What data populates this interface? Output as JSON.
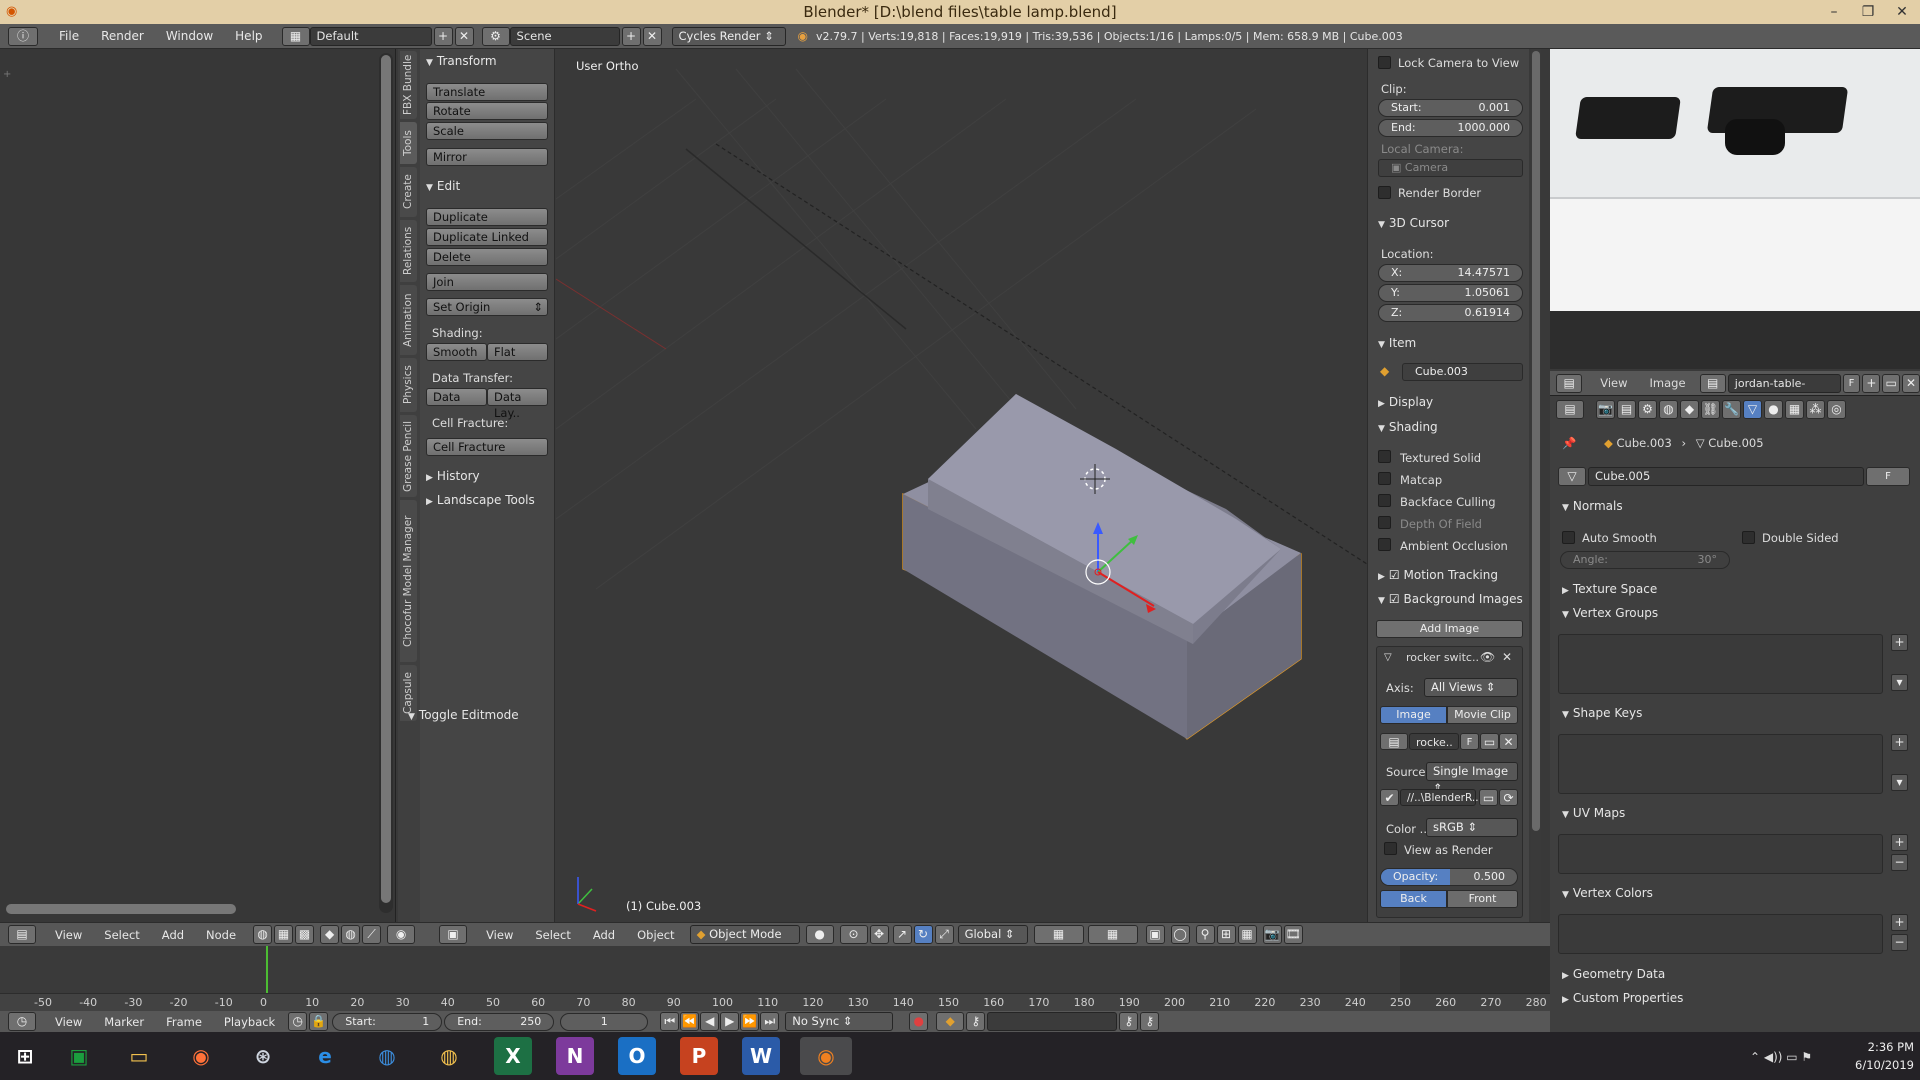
{
  "title": "Blender* [D:\\blend files\\table lamp.blend]",
  "menu": [
    "File",
    "Render",
    "Window",
    "Help"
  ],
  "layout": "Default",
  "scene": "Scene",
  "engine": "Cycles Render",
  "stats": "v2.79.7 | Verts:19,818 | Faces:19,919 | Tris:39,536 | Objects:1/16 | Lamps:0/5 | Mem: 658.9 MB | Cube.003",
  "tabs": [
    "FBX Bundle",
    "Tools",
    "Create",
    "Relations",
    "Animation",
    "Physics",
    "Grease Pencil",
    "Chocofur Model Manager",
    "Capsule"
  ],
  "tools": {
    "transform": "Transform",
    "translate": "Translate",
    "rotate": "Rotate",
    "scale": "Scale",
    "mirror": "Mirror",
    "edit": "Edit",
    "duplicate": "Duplicate",
    "duplicate_linked": "Duplicate Linked",
    "delete": "Delete",
    "join": "Join",
    "set_origin": "Set Origin",
    "shading": "Shading:",
    "smooth": "Smooth",
    "flat": "Flat",
    "data_transfer": "Data Transfer:",
    "data": "Data",
    "data_lay": "Data Lay..",
    "cell_fracture_lbl": "Cell Fracture:",
    "cell_fracture": "Cell Fracture",
    "history": "History",
    "landscape": "Landscape Tools",
    "toggle_editmode": "Toggle Editmode"
  },
  "viewport": {
    "view_name": "User Ortho",
    "object_label": "(1) Cube.003"
  },
  "npanel": {
    "lock_camera": "Lock Camera to View",
    "clip": "Clip:",
    "start_lbl": "Start:",
    "start": "0.001",
    "end_lbl": "End:",
    "end": "1000.000",
    "local_camera": "Local Camera:",
    "camera": "Camera",
    "render_border": "Render Border",
    "cursor": "3D Cursor",
    "location": "Location:",
    "x_lbl": "X:",
    "x": "14.47571",
    "y_lbl": "Y:",
    "y": "1.05061",
    "z_lbl": "Z:",
    "z": "0.61914",
    "item": "Item",
    "item_name": "Cube.003",
    "display": "Display",
    "shading": "Shading",
    "textured_solid": "Textured Solid",
    "matcap": "Matcap",
    "backface": "Backface Culling",
    "dof": "Depth Of Field",
    "ao": "Ambient Occlusion",
    "motion_tracking": "Motion Tracking",
    "bg_images": "Background Images",
    "add_image": "Add Image",
    "bg_name": "rocker switc..",
    "axis_lbl": "Axis:",
    "axis": "All Views",
    "image_tab": "Image",
    "movie_tab": "Movie Clip",
    "img_field": "rocke..",
    "f": "F",
    "source_lbl": "Source:",
    "source": "Single Image",
    "path": "//..\\BlenderR..",
    "color_lbl": "Color ..",
    "color": "sRGB",
    "view_as_render": "View as Render",
    "opacity_lbl": "Opacity:",
    "opacity": "0.500",
    "back": "Back",
    "front": "Front"
  },
  "image_editor": {
    "view": "View",
    "image": "Image",
    "file": "jordan-table-lamp.jpg",
    "f": "F"
  },
  "props": {
    "obj": "Cube.003",
    "mesh": "Cube.005",
    "mesh_field": "Cube.005",
    "f": "F",
    "normals": "Normals",
    "auto_smooth": "Auto Smooth",
    "double_sided": "Double Sided",
    "angle_lbl": "Angle:",
    "angle": "30°",
    "texture_space": "Texture Space",
    "vertex_groups": "Vertex Groups",
    "shape_keys": "Shape Keys",
    "uv_maps": "UV Maps",
    "vertex_colors": "Vertex Colors",
    "geometry_data": "Geometry Data",
    "custom_props": "Custom Properties"
  },
  "node_hdr": [
    "View",
    "Select",
    "Add",
    "Node"
  ],
  "view3d_hdr": {
    "items": [
      "View",
      "Select",
      "Add",
      "Object"
    ],
    "mode": "Object Mode",
    "orientation": "Global"
  },
  "ruler": [
    "-50",
    "-40",
    "-30",
    "-20",
    "-10",
    "0",
    "10",
    "20",
    "30",
    "40",
    "50",
    "60",
    "70",
    "80",
    "90",
    "100",
    "110",
    "120",
    "130",
    "140",
    "150",
    "160",
    "170",
    "180",
    "190",
    "200",
    "210",
    "220",
    "230",
    "240",
    "250",
    "260",
    "270",
    "280"
  ],
  "timeline": {
    "items": [
      "View",
      "Marker",
      "Frame",
      "Playback"
    ],
    "start_lbl": "Start:",
    "start": "1",
    "end_lbl": "End:",
    "end": "250",
    "frame": "1",
    "sync": "No Sync"
  },
  "clock": {
    "time": "2:36 PM",
    "date": "6/10/2019"
  },
  "colors": {
    "selection": "#f0a020",
    "header": "#575757",
    "panel": "#454545",
    "accent": "#5680c2"
  }
}
